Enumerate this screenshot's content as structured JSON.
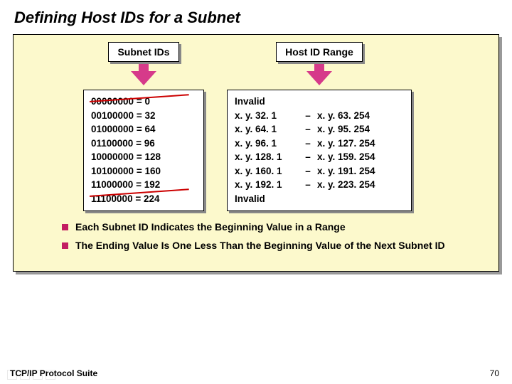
{
  "title": "Defining Host IDs for a Subnet",
  "headers": {
    "subnet": "Subnet IDs",
    "range": "Host ID Range"
  },
  "subnet_rows": [
    {
      "bin": "00000000",
      "val": "0",
      "struck": true
    },
    {
      "bin": "00100000",
      "val": "32",
      "struck": false
    },
    {
      "bin": "01000000",
      "val": "64",
      "struck": false
    },
    {
      "bin": "01100000",
      "val": "96",
      "struck": false
    },
    {
      "bin": "10000000",
      "val": "128",
      "struck": false
    },
    {
      "bin": "10100000",
      "val": "160",
      "struck": false
    },
    {
      "bin": "11000000",
      "val": "192",
      "struck": false
    },
    {
      "bin": "11100000",
      "val": "224",
      "struck": true
    }
  ],
  "range_rows": [
    {
      "left": "Invalid",
      "dash": "",
      "right": ""
    },
    {
      "left": "x. y. 32. 1",
      "dash": "–",
      "right": "x. y. 63. 254"
    },
    {
      "left": "x. y. 64. 1",
      "dash": "–",
      "right": "x. y. 95. 254"
    },
    {
      "left": "x. y. 96. 1",
      "dash": "–",
      "right": "x. y. 127. 254"
    },
    {
      "left": "x. y. 128. 1",
      "dash": "–",
      "right": "x. y. 159. 254"
    },
    {
      "left": "x. y. 160. 1",
      "dash": "–",
      "right": "x. y. 191. 254"
    },
    {
      "left": "x. y. 192. 1",
      "dash": "–",
      "right": "x. y. 223. 254"
    },
    {
      "left": "Invalid",
      "dash": "",
      "right": ""
    }
  ],
  "bullets": [
    "Each Subnet ID Indicates the Beginning Value in a Range",
    "The Ending Value Is One Less Than the Beginning Value of the Next Subnet ID"
  ],
  "footer": "TCP/IP Protocol Suite",
  "page": "70"
}
